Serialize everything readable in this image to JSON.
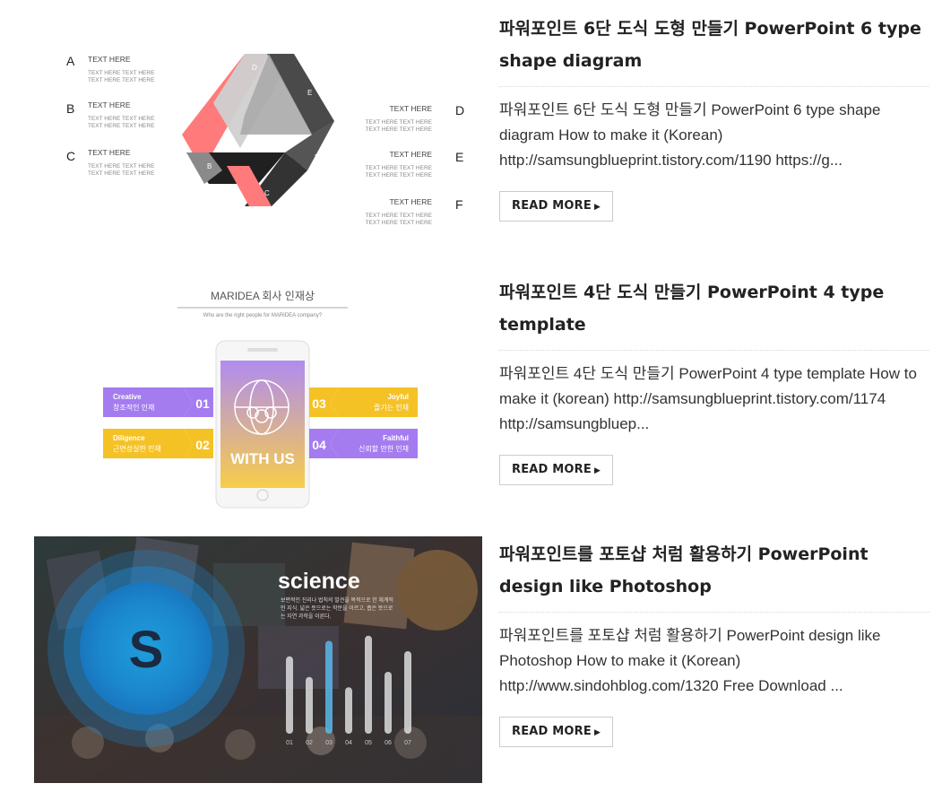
{
  "posts": [
    {
      "title": "파워포인트 6단 도식 도형 만들기 PowerPoint 6 type shape diagram",
      "excerpt": "파워포인트 6단 도식 도형 만들기 PowerPoint 6 type shape diagram How to make it (Korean) http://samsungblueprint.tistory.com/1190 https://g...",
      "read_more": "READ MORE",
      "thumb": {
        "left_letters": [
          "A",
          "B",
          "C"
        ],
        "right_letters": [
          "D",
          "E",
          "F"
        ],
        "item_heading": "TEXT HERE",
        "item_sub": "TEXT HERE TEXT HERE",
        "segment_labels": [
          "A",
          "B",
          "C",
          "D",
          "E",
          "F"
        ]
      }
    },
    {
      "title": "파워포인트 4단 도식 만들기 PowerPoint 4 type template",
      "excerpt": "파워포인트 4단 도식 만들기 PowerPoint 4 type template How to make it (korean) http://samsungblueprint.tistory.com/1174 http://samsungbluep...",
      "read_more": "READ MORE",
      "thumb": {
        "heading": "MARIDEA 회사 인재상",
        "subheading": "Who are the right people for MARIDEA company?",
        "center_text": "WITH US",
        "cards": [
          {
            "num": "01",
            "en": "Creative",
            "ko": "창조적인 인재"
          },
          {
            "num": "02",
            "en": "Diligence",
            "ko": "근면성실한 인재"
          },
          {
            "num": "03",
            "en": "Joyful",
            "ko": "즐기는 인재"
          },
          {
            "num": "04",
            "en": "Faithful",
            "ko": "신뢰할 만한 인재"
          }
        ]
      }
    },
    {
      "title": "파워포인트를 포토샵 처럼 활용하기 PowerPoint design like Photoshop",
      "excerpt": "파워포인트를 포토샵 처럼 활용하기 PowerPoint design like Photoshop How to make it (Korean) http://www.sindohblog.com/1320 Free Download ...",
      "read_more": "READ MORE",
      "thumb": {
        "logo_letter": "S",
        "headline": "science",
        "body_line_1": "보편적인 진리나 법칙의 발견을 목적으로 한 체계적",
        "body_line_2": "인 지식. 넓은 뜻으로는 학문을 이르고, 좁은 뜻으로",
        "body_line_3": "는 자연 과학을 이른다.",
        "bar_labels": [
          "01",
          "02",
          "03",
          "04",
          "05",
          "06",
          "07"
        ],
        "bar_values": [
          0.75,
          0.55,
          0.9,
          0.45,
          0.95,
          0.6,
          0.8
        ]
      }
    }
  ]
}
